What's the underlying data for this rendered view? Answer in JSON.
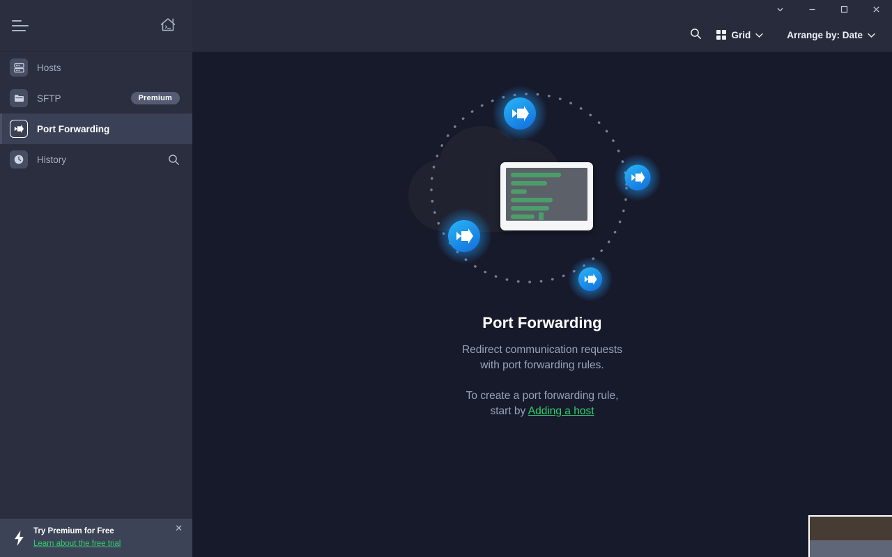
{
  "window": {
    "controls": [
      {
        "name": "more-chevron",
        "label": "⌄"
      },
      {
        "name": "minimize",
        "label": "—"
      },
      {
        "name": "maximize",
        "label": "□"
      },
      {
        "name": "close",
        "label": "✕"
      }
    ]
  },
  "toolbar": {
    "search_icon": "search-icon",
    "view_label": "Grid",
    "view_chevron": "⌄",
    "arrange_label": "Arrange by: Date",
    "arrange_chevron": "⌄"
  },
  "sidebar": {
    "menu_icon": "hamburger-icon",
    "home_icon": "home-terminal-icon",
    "items": [
      {
        "label": "Hosts",
        "icon": "server-rack-icon",
        "active": false,
        "badge": ""
      },
      {
        "label": "SFTP",
        "icon": "folder-icon",
        "active": false,
        "badge": "Premium"
      },
      {
        "label": "Port Forwarding",
        "icon": "port-forward-arrow-icon",
        "active": true,
        "badge": ""
      },
      {
        "label": "History",
        "icon": "clock-icon",
        "active": false,
        "badge": ""
      }
    ],
    "history_search_icon": "search-icon",
    "promo": {
      "icon": "lightning-bolt-icon",
      "title": "Try Premium for Free",
      "link": "Learn about the free trial",
      "close_icon": "close-icon",
      "close_label": "✕"
    }
  },
  "main": {
    "illustration": {
      "name": "port-forwarding-illustration",
      "cloud": "cloud-shape",
      "terminal": "terminal-window",
      "terminal_lines": 6,
      "badge_count": 4,
      "badge_icon": "port-forward-arrow-icon"
    },
    "title": "Port Forwarding",
    "subtitle_line1": "Redirect communication requests",
    "subtitle_line2": "with port forwarding rules.",
    "cta_line1": "To create a port forwarding rule,",
    "cta_prefix": "start by ",
    "cta_link": "Adding a host"
  },
  "thumbnail": {
    "name": "image-thumbnail-preview"
  },
  "colors": {
    "sidebar_bg": "#2a2e3e",
    "main_bg": "#171a2a",
    "titlebar_bg": "#272b3b",
    "active_item": "#3a4055",
    "accent_green": "#2fcf6f",
    "badge_blue": "#1e9ef0",
    "promo_bg": "#3d4357",
    "terminal_green": "#4c9e6b"
  }
}
